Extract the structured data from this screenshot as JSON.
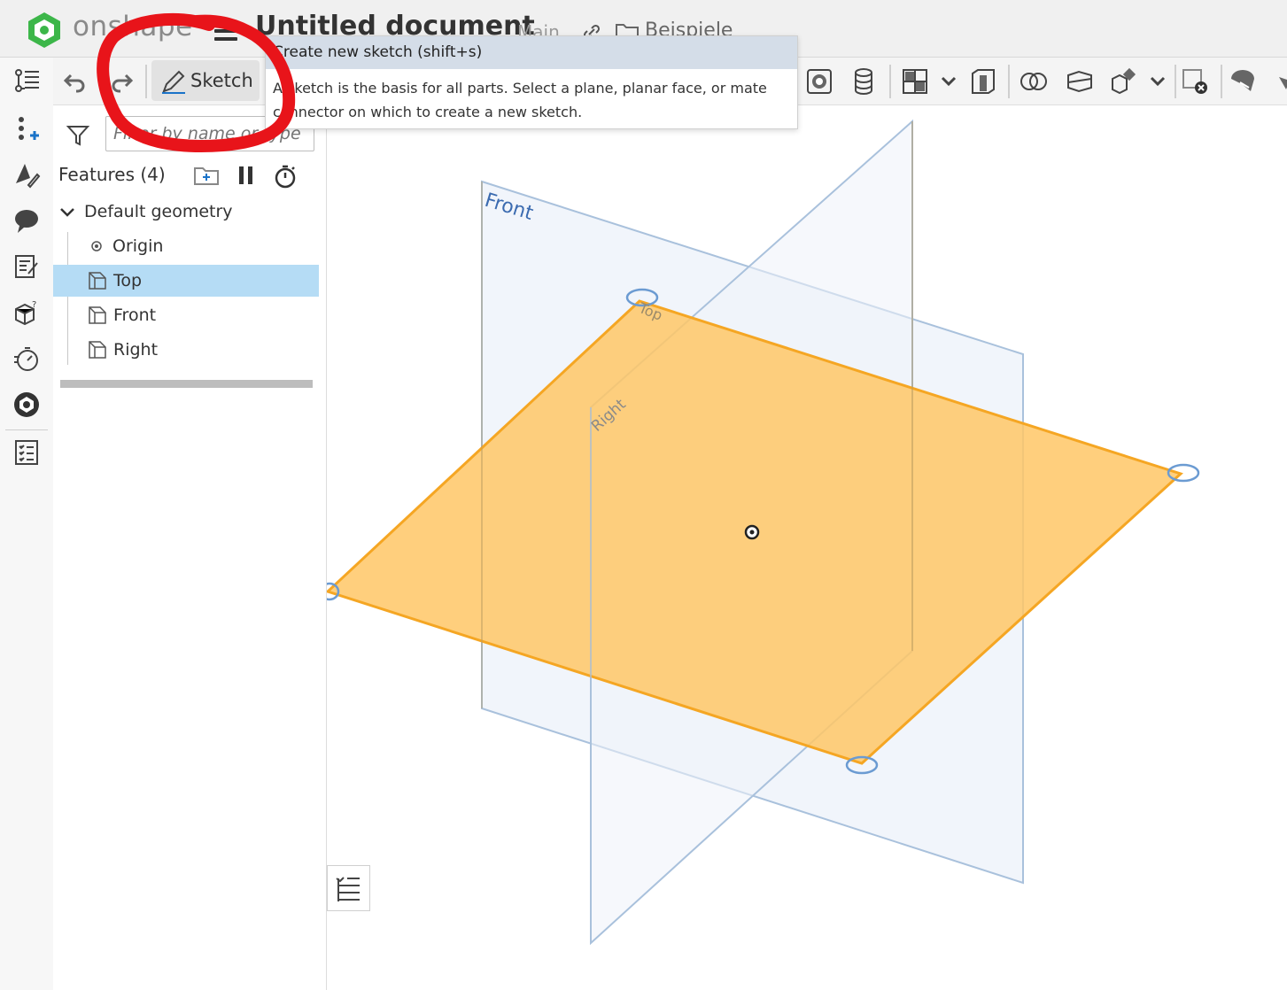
{
  "header": {
    "logo_text": "onshape",
    "document_title": "Untitled document",
    "branch": "Main",
    "folder": "Beispiele"
  },
  "toolbar": {
    "sketch_label": "Sketch"
  },
  "tooltip": {
    "title": "Create new sketch (shift+s)",
    "body": "A sketch is the basis for all parts. Select a plane, planar face, or mate connector on which to create a new sketch."
  },
  "feature_panel": {
    "filter_placeholder": "Filter by name or type",
    "features_label": "Features (4)",
    "group_label": "Default geometry",
    "items": [
      {
        "label": "Origin",
        "icon": "origin-icon"
      },
      {
        "label": "Top",
        "icon": "plane-icon",
        "selected": true
      },
      {
        "label": "Front",
        "icon": "plane-icon"
      },
      {
        "label": "Right",
        "icon": "plane-icon"
      }
    ]
  },
  "viewport": {
    "plane_labels": {
      "front": "Front",
      "top": "Top",
      "right": "Right"
    },
    "colors": {
      "selected_plane": "#ffc766",
      "selected_edge": "#f5a623",
      "plane_fill": "#eef3fa",
      "plane_edge": "#a9c1dc"
    }
  },
  "colors": {
    "selection": "#b5dcf5",
    "annotation": "#e8141a",
    "brand_green": "#3cb649"
  }
}
